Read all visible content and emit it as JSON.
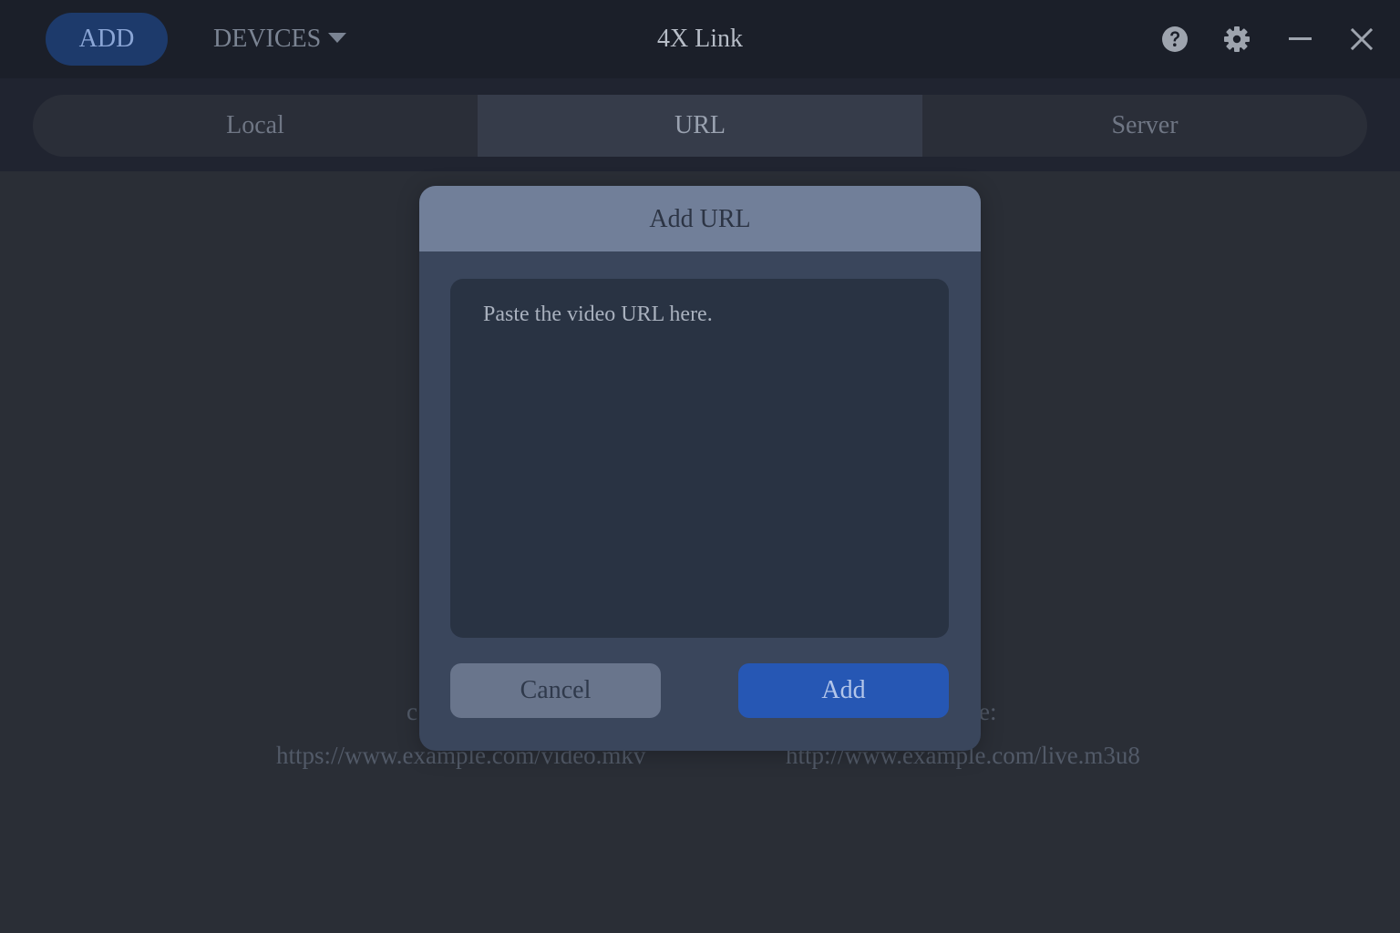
{
  "titlebar": {
    "add_label": "ADD",
    "devices_label": "DEVICES",
    "title": "4X Link",
    "icons": {
      "help": "help-icon",
      "settings": "gear-icon",
      "minimize": "minimize-icon",
      "close": "close-icon"
    }
  },
  "tabs": [
    {
      "label": "Local",
      "active": false
    },
    {
      "label": "URL",
      "active": true
    },
    {
      "label": "Server",
      "active": false
    }
  ],
  "background_hints": {
    "left_label_fragment": "c",
    "right_label_fragment": "e:",
    "left_url": "https://www.example.com/video.mkv",
    "right_url": "http://www.example.com/live.m3u8"
  },
  "modal": {
    "title": "Add URL",
    "textarea_placeholder": "Paste the video URL here.",
    "textarea_value": "",
    "cancel_label": "Cancel",
    "add_label": "Add"
  },
  "colors": {
    "titlebar_bg": "#1b1f29",
    "accent_blue": "#2657b4",
    "add_pill_bg": "#1d3a6b",
    "modal_header_bg": "#717f99",
    "modal_body_bg": "#3a465c"
  }
}
